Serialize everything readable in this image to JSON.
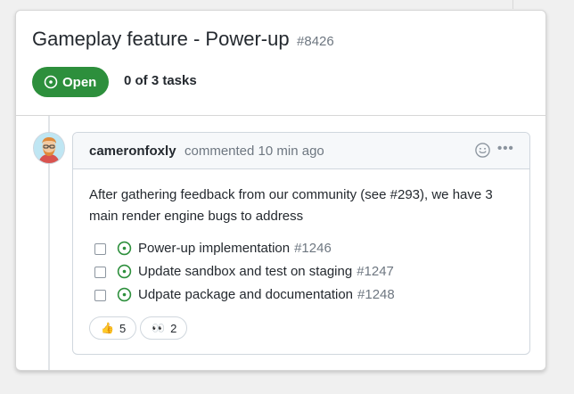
{
  "issue": {
    "title": "Gameplay feature - Power-up",
    "number": "#8426",
    "status": "Open",
    "task_summary": "0 of 3 tasks"
  },
  "comment": {
    "author": "cameronfoxly",
    "meta": "commented 10 min ago",
    "body": "After gathering feedback from our community (see #293), we have 3 main render engine bugs to address",
    "tasks": [
      {
        "label": "Power-up implementation",
        "ref": "#1246",
        "checked": false
      },
      {
        "label": "Update sandbox and test on staging",
        "ref": "#1247",
        "checked": false
      },
      {
        "label": "Udpate package and documentation",
        "ref": "#1248",
        "checked": false
      }
    ],
    "reactions": [
      {
        "icon": "thumbs-up-icon",
        "glyph": "👍",
        "count": "5"
      },
      {
        "icon": "eyes-icon",
        "glyph": "👀",
        "count": "2"
      }
    ]
  },
  "colors": {
    "open_green": "#2d8f3c",
    "muted_text": "#6e7781",
    "border": "#d0d7de"
  }
}
